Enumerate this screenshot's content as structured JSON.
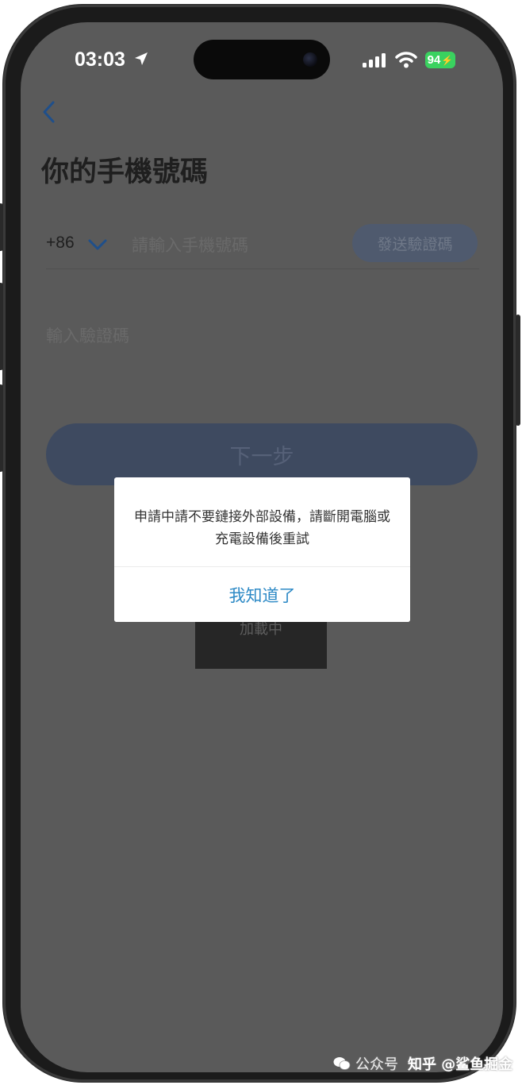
{
  "status_bar": {
    "time": "03:03",
    "battery": "94"
  },
  "page": {
    "title": "你的手機號碼",
    "country_code": "+86",
    "phone_placeholder": "請輸入手機號碼",
    "send_code_label": "發送驗證碼",
    "code_placeholder": "輸入驗證碼",
    "next_label": "下一步"
  },
  "loading": {
    "text": "加載中"
  },
  "alert": {
    "message": "申請中請不要鏈接外部設備，請斷開電腦或充電設備後重試",
    "button_label": "我知道了"
  },
  "watermark": {
    "account": "公众号",
    "brand": "知乎 @鲨鱼掘金"
  },
  "colors": {
    "accent": "#2e8ac6",
    "battery": "#3ad25f",
    "overlay": "#5a5a5a"
  },
  "icons": [
    "location-arrow-icon",
    "cellular-signal-icon",
    "wifi-icon",
    "battery-icon",
    "back-chevron-icon",
    "chevron-down-icon",
    "wechat-logo-icon"
  ]
}
